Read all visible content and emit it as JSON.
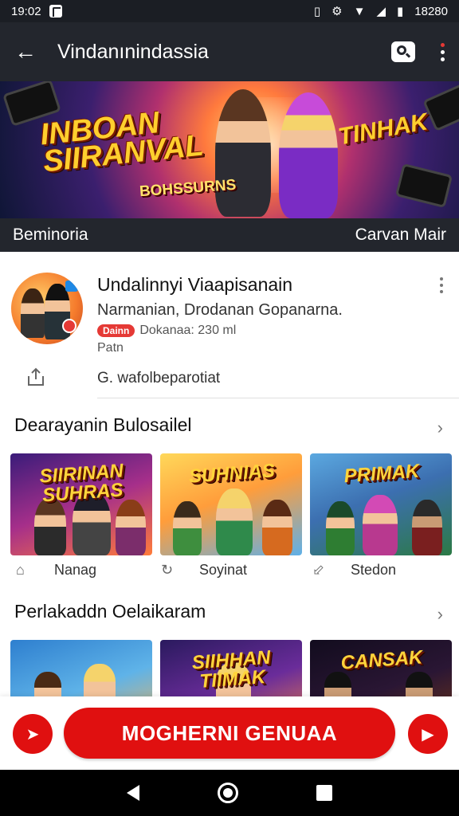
{
  "status_bar": {
    "time": "19:02",
    "clock_right": "18280"
  },
  "app_bar": {
    "title": "Vindanınindassia"
  },
  "banner": {
    "logo_left_line1": "INBOAN",
    "logo_left_line2": "SIIRANVAL",
    "logo_right": "TINHAK",
    "subtitle": "BOHSSURNS",
    "caption_left": "Beminoria",
    "caption_right": "Carvan Mair"
  },
  "app": {
    "title": "Undalinnyi Viaapisanain",
    "developer": "Narmanian, Drodanan Gopanarna.",
    "badge": "Dainn",
    "downloads": "Dokanaa: 230 ml",
    "extra": "Patn",
    "share_text": "G. wafolbeparotiat"
  },
  "section1": {
    "title": "Dearayanin Bulosailel",
    "cards": [
      {
        "title": "SIIRINAN SUHRAS",
        "label": "Nanag",
        "icon": "home-outline-icon"
      },
      {
        "title": "SUHNIAS",
        "label": "Soyinat",
        "icon": "refresh-icon"
      },
      {
        "title": "PRIMAK",
        "label": "Stedon",
        "icon": "arrow-diagonal-icon"
      }
    ]
  },
  "section2": {
    "title": "Perlakaddn Oelaikaram",
    "cards": [
      {
        "title": ""
      },
      {
        "title": "SIIHHAN TIIMAK"
      },
      {
        "title": "CANSAK"
      }
    ]
  },
  "cta": {
    "label": "MOGHERNI GENUAA"
  },
  "colors": {
    "accent": "#e01010",
    "app_bar": "#23262d"
  }
}
